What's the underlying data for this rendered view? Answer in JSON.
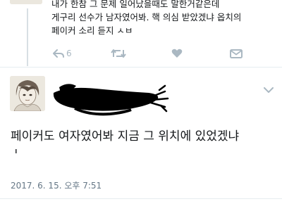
{
  "previous_tweet": {
    "lines": [
      "내가 한참 그 문제 일어났을때도 말한거같은데",
      "게구리 선수가 남자였어봐. 핵 의심 받았겠냐 옵치의",
      "페이커 소리 듣지 ㅅㅂ"
    ],
    "actions": {
      "reply_icon": "reply-icon",
      "reply_count": "6",
      "retweet_icon": "retweet-icon",
      "like_icon": "heart-icon",
      "dm_icon": "mail-icon"
    }
  },
  "main_tweet": {
    "text": "페이커도 여자였어봐 지금 그 위치에 있었겠냐",
    "text_cont": "ㅗ",
    "timestamp": "2017. 6. 15. 오후 7:51",
    "menu_icon": "chevron-down-icon",
    "redaction_color": "#000000"
  },
  "colors": {
    "icon": "#aab8c2",
    "divider": "#e6ecf0",
    "thread_line": "#d8dfe4",
    "timestamp": "#657786"
  }
}
